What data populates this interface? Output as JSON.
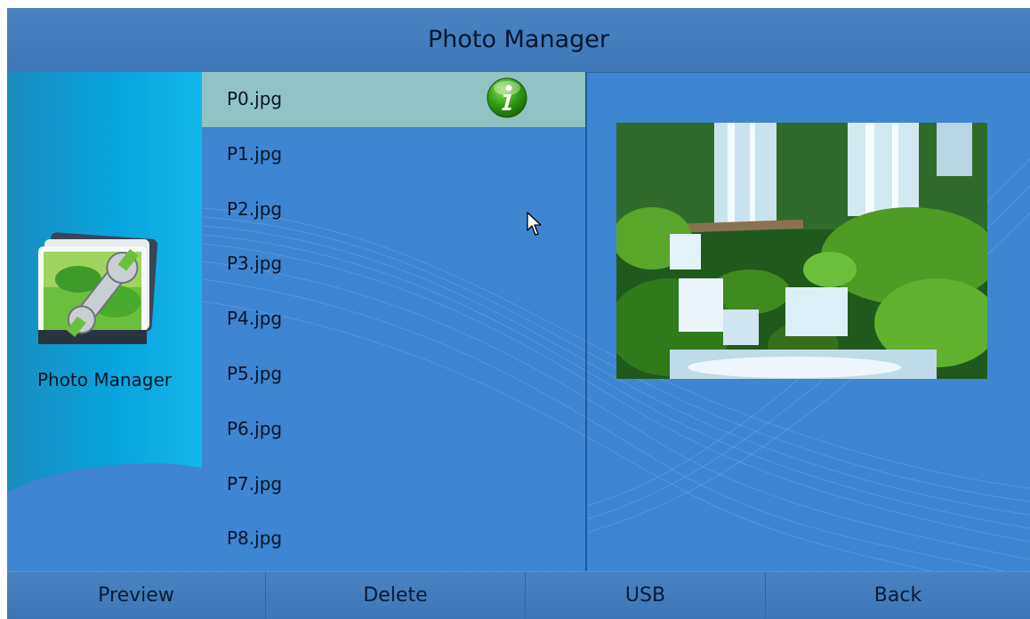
{
  "header": {
    "title": "Photo Manager"
  },
  "sidebar": {
    "app_label": "Photo Manager",
    "app_icon": "photo-tool-icon"
  },
  "file_list": {
    "items": [
      "P0.jpg",
      "P1.jpg",
      "P2.jpg",
      "P3.jpg",
      "P4.jpg",
      "P5.jpg",
      "P6.jpg",
      "P7.jpg",
      "P8.jpg"
    ],
    "selected": "P0.jpg",
    "selected_badge_icon": "info-icon"
  },
  "preview": {
    "image_subject": "waterfall-over-mossy-rocks"
  },
  "footer": {
    "buttons": [
      {
        "label": "Preview"
      },
      {
        "label": "Delete"
      },
      {
        "label": "USB"
      },
      {
        "label": "Back"
      }
    ]
  },
  "colors": {
    "background_blue": "#3e85d2",
    "bar_blue": "#4a83c2",
    "selection_teal": "#8fc3c4",
    "sidebar_cyan": "#08a4df",
    "info_green": "#2f9a12"
  }
}
